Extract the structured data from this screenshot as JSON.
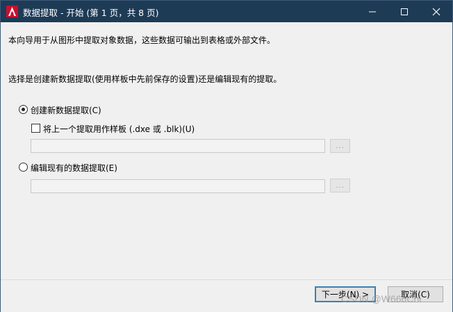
{
  "window": {
    "title": "数据提取 - 开始 (第 1 页，共 8 页)",
    "app_icon": "autocad-a-icon",
    "accent_color": "#1e3b56"
  },
  "content": {
    "intro_text": "本向导用于从图形中提取对象数据，这些数据可输出到表格或外部文件。",
    "question_text": "选择是创建新数据提取(使用样板中先前保存的设置)还是编辑现有的提取。",
    "option_create": {
      "label": "创建新数据提取(C)",
      "selected": true
    },
    "template_checkbox": {
      "label": "将上一个提取用作样板 (.dxe 或 .blk)(U)",
      "checked": false
    },
    "template_path": {
      "value": ""
    },
    "option_edit": {
      "label": "编辑现有的数据提取(E)",
      "selected": false
    },
    "edit_path": {
      "value": ""
    },
    "browse_label": "..."
  },
  "footer": {
    "next_label": "下一步(N) >",
    "cancel_label": "取消(C)"
  },
  "watermark": "CSDN @W666Chi"
}
